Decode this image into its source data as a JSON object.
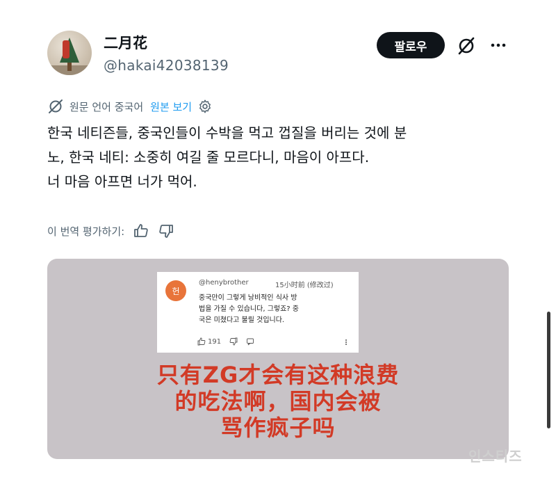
{
  "user": {
    "display_name": "二月花",
    "handle": "@hakai42038139"
  },
  "header": {
    "follow_label": "팔로우",
    "grok_icon": "grok-slash-icon",
    "more_icon": "more-dots-icon"
  },
  "translation": {
    "info": "원문 언어 중국어",
    "view_original": "원본 보기"
  },
  "tweet": {
    "lines": [
      "한국 네티즌들, 중국인들이 수박을 먹고 껍질을 버리는 것에 분",
      "노, 한국 네티: 소중히 여길 줄 모르다니, 마음이 아프다.",
      "너 마음 아프면 너가 먹어."
    ]
  },
  "rating": {
    "label": "이 번역 평가하기:"
  },
  "media": {
    "comment": {
      "avatar_char": "헌",
      "username": "@henybrother",
      "time": "15小时前  (修改过)",
      "body_lines": [
        "중국만이 그렇게 낭비적인 식사 방",
        "법을 가질 수 있습니다, 그렇죠? 중",
        "국은 미쳤다고 불릴 것입니다."
      ],
      "likes": "191"
    },
    "caption_lines": [
      "只有ZG才会有这种浪费",
      "的吃法啊，国内会被",
      "骂作疯子吗"
    ],
    "caption_color": "#d23a26"
  },
  "watermark": "인스티즈",
  "colors": {
    "accent_link": "#1d9bf0",
    "follow_bg": "#0f1419"
  }
}
